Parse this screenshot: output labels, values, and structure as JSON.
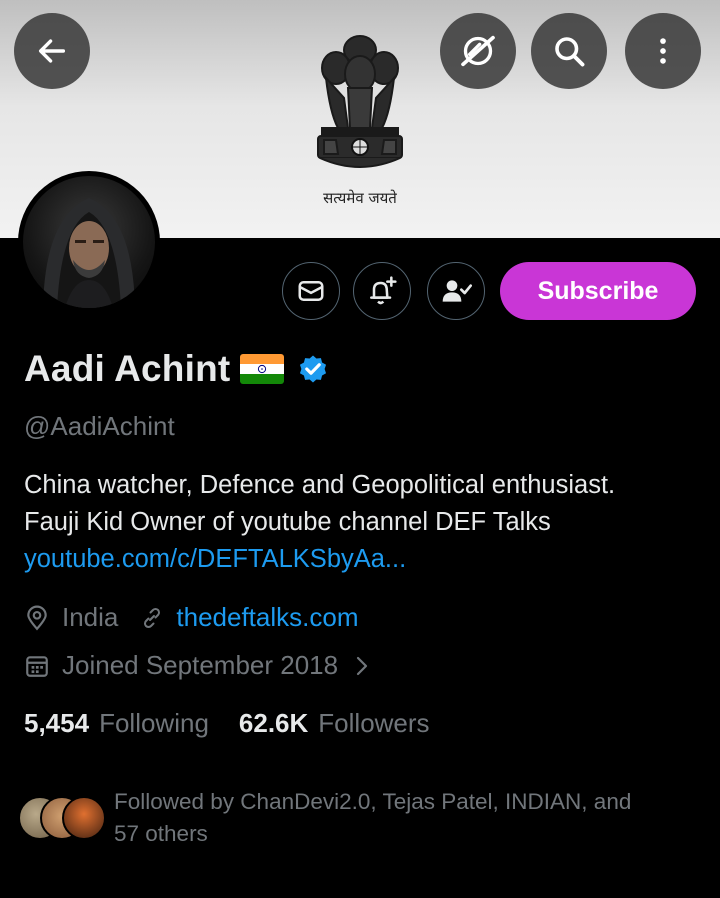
{
  "banner": {
    "motto": "सत्यमेव जयते",
    "emblem_icon": "ashoka-emblem-icon"
  },
  "toolbar": {
    "back_icon": "arrow-left-icon",
    "grok_icon": "grok-icon",
    "search_icon": "search-icon",
    "more_icon": "more-vertical-icon"
  },
  "actions": {
    "message_icon": "envelope-icon",
    "notify_icon": "bell-plus-icon",
    "following_icon": "person-check-icon",
    "subscribe_label": "Subscribe"
  },
  "profile": {
    "display_name": "Aadi Achint",
    "flag": "india-flag-icon",
    "verified_icon": "verified-badge-icon",
    "handle": "@AadiAchint",
    "bio_line1": "China watcher, Defence and Geopolitical enthusiast.",
    "bio_line2": "Fauji Kid Owner of youtube channel DEF Talks",
    "bio_link": "youtube.com/c/DEFTALKSbyAa...",
    "location": "India",
    "website": "thedeftalks.com",
    "joined": "Joined September 2018",
    "following_count": "5,454",
    "following_label": "Following",
    "followers_count": "62.6K",
    "followers_label": "Followers",
    "followed_by_line1": "Followed by ChanDevi2.0, Tejas Patel, INDIAN, and",
    "followed_by_line2": "57 others"
  },
  "colors": {
    "accent_blue": "#1d9bf0",
    "subscribe_purple": "#c936d6",
    "muted_text": "#71767b"
  }
}
